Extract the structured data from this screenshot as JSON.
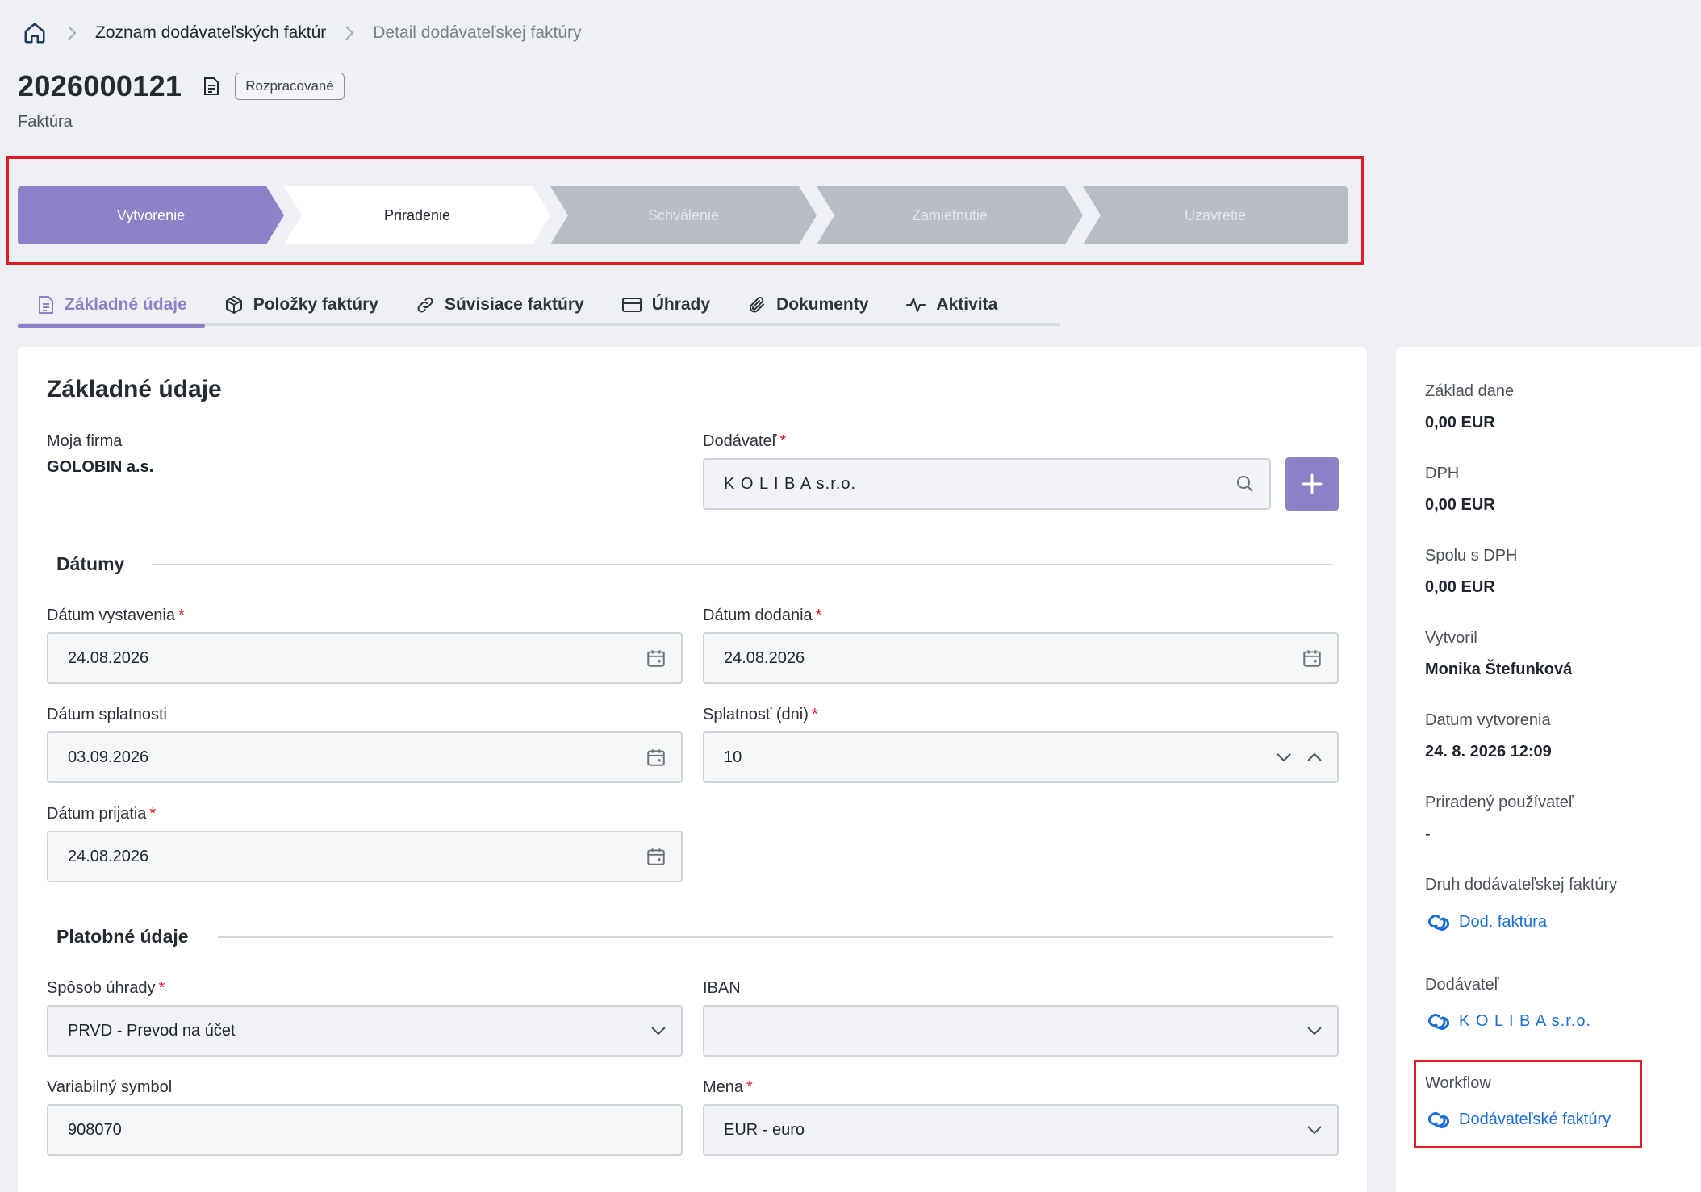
{
  "breadcrumb": {
    "home_icon": "home-icon",
    "items": [
      "Zoznam dodávateľských faktúr",
      "Detail dodávateľskej faktúry"
    ]
  },
  "header": {
    "number": "2026000121",
    "status": "Rozpracované",
    "type": "Faktúra"
  },
  "stepper": {
    "steps": [
      {
        "label": "Vytvorenie",
        "state": "done"
      },
      {
        "label": "Priradenie",
        "state": "current"
      },
      {
        "label": "Schválenie",
        "state": "pending"
      },
      {
        "label": "Zamietnutie",
        "state": "pending"
      },
      {
        "label": "Uzavretie",
        "state": "pending"
      }
    ],
    "colors": {
      "done": "#8b82c8",
      "current": "#ffffff",
      "pending": "#b7bcc5"
    }
  },
  "tabs": [
    {
      "label": "Základné údaje",
      "icon": "document-icon",
      "active": true
    },
    {
      "label": "Položky faktúry",
      "icon": "box-icon",
      "active": false
    },
    {
      "label": "Súvisiace faktúry",
      "icon": "link-icon",
      "active": false
    },
    {
      "label": "Úhrady",
      "icon": "card-icon",
      "active": false
    },
    {
      "label": "Dokumenty",
      "icon": "paperclip-icon",
      "active": false
    },
    {
      "label": "Aktivita",
      "icon": "activity-icon",
      "active": false
    }
  ],
  "form": {
    "title": "Základné údaje",
    "my_company_label": "Moja firma",
    "my_company_value": "GOLOBIN a.s.",
    "supplier_label": "Dodávateľ",
    "supplier_value": "K O L I B A s.r.o.",
    "dates_section": "Dátumy",
    "issue_date_label": "Dátum vystavenia",
    "issue_date_value": "24.08.2026",
    "delivery_date_label": "Dátum dodania",
    "delivery_date_value": "24.08.2026",
    "due_date_label": "Dátum splatnosti",
    "due_date_value": "03.09.2026",
    "due_days_label": "Splatnosť (dni)",
    "due_days_value": "10",
    "received_date_label": "Dátum prijatia",
    "received_date_value": "24.08.2026",
    "payment_section": "Platobné údaje",
    "payment_method_label": "Spôsob úhrady",
    "payment_method_value": "PRVD - Prevod na účet",
    "iban_label": "IBAN",
    "iban_value": "",
    "variable_symbol_label": "Variabilný symbol",
    "variable_symbol_value": "908070",
    "currency_label": "Mena",
    "currency_value": "EUR - euro",
    "required_mark": "*"
  },
  "sidebar": {
    "tax_base_label": "Základ dane",
    "tax_base_value": "0,00 EUR",
    "vat_label": "DPH",
    "vat_value": "0,00 EUR",
    "total_label": "Spolu s DPH",
    "total_value": "0,00 EUR",
    "created_by_label": "Vytvoril",
    "created_by_value": "Monika Štefunková",
    "created_date_label": "Datum vytvorenia",
    "created_date_value": "24. 8. 2026 12:09",
    "assigned_user_label": "Priradený používateľ",
    "assigned_user_value": "-",
    "invoice_kind_label": "Druh dodávateľskej faktúry",
    "invoice_kind_link": "Dod. faktúra",
    "supplier_label": "Dodávateľ",
    "supplier_link": "K O L I B A s.r.o.",
    "workflow_label": "Workflow",
    "workflow_link": "Dodávateľské faktúry"
  },
  "colors": {
    "accent": "#8b82c8",
    "link": "#1a6fd6",
    "highlight": "#e01b24"
  }
}
